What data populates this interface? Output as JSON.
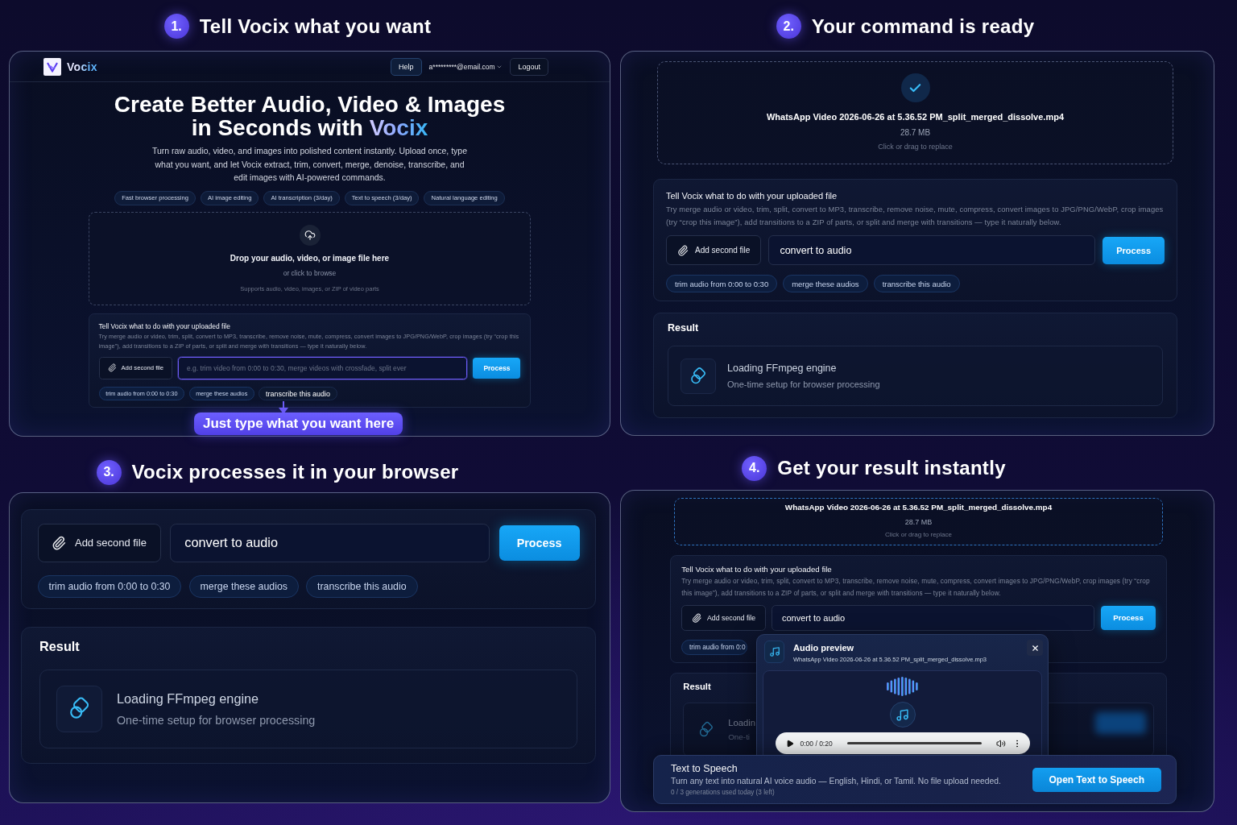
{
  "step_1": {
    "number": "1.",
    "title": "Tell Vocix what you want",
    "header": {
      "brand": "Vocix",
      "help": "Help",
      "account": "a*********@email.com",
      "logout": "Logout"
    },
    "hero": {
      "headline_lines": [
        "Create Better Audio, Video & Images",
        "in Seconds with"
      ],
      "headline_highlight": "Vocix",
      "intro": "Turn raw audio, video, and images into polished content instantly. Upload once, type what you want, and let Vocix extract, trim, convert, merge, denoise, transcribe, and edit images with AI-powered commands.",
      "features": [
        "Fast browser processing",
        "AI image editing",
        "AI transcription (3/day)",
        "Text to speech (3/day)",
        "Natural language editing"
      ]
    },
    "dropzone": {
      "title": "Drop your audio, video, or image file here",
      "browse": "or click to browse",
      "supports": "Supports audio, video, images, or ZIP of video parts"
    },
    "command": {
      "title": "Tell Vocix what to do with your uploaded file",
      "hint": "Try merge audio or video, trim, split, convert to MP3, transcribe, remove noise, mute, compress, convert images to JPG/PNG/WebP, crop images (try “crop this image”), add transitions to a ZIP of parts, or split and merge with transitions — type it naturally below.",
      "add_file": "Add second file",
      "input": {
        "placeholder": "e.g. trim video from 0:00 to 0:30, merge videos with crossfade, split ever",
        "focused": true
      },
      "process": "Process",
      "suggestions": [
        {
          "label": "trim audio from 0:00 to 0:30",
          "highlighted": false
        },
        {
          "label": "merge these audios",
          "highlighted": false
        },
        {
          "label": "transcribe this audio",
          "highlighted": true
        }
      ]
    },
    "callout": "Just type what you want here"
  },
  "step_2": {
    "number": "2.",
    "title": "Your command is ready",
    "file": {
      "name": "WhatsApp Video 2026-06-26 at 5.36.52 PM_split_merged_dissolve.mp4",
      "size": "28.7 MB",
      "action": "Click or drag to replace",
      "verified": true,
      "highlighted": false
    },
    "command": {
      "title": "Tell Vocix what to do with your uploaded file",
      "hint": "Try merge audio or video, trim, split, convert to MP3, transcribe, remove noise, mute, compress, convert images to JPG/PNG/WebP, crop images (try “crop this image”), add transitions to a ZIP of parts, or split and merge with transitions — type it naturally below.",
      "add_file": "Add second file",
      "input": {
        "value": "convert to audio",
        "focused": false
      },
      "process": "Process",
      "suggestions": [
        {
          "label": "trim audio from 0:00 to 0:30",
          "highlighted": false
        },
        {
          "label": "merge these audios",
          "highlighted": false
        },
        {
          "label": "transcribe this audio",
          "highlighted": false
        }
      ]
    },
    "result": {
      "title": "Result",
      "status": {
        "title": "Loading FFmpeg engine",
        "detail": "One-time setup for browser processing"
      },
      "dimmed": false
    }
  },
  "step_3": {
    "number": "3.",
    "title": "Vocix processes it in your browser",
    "command": {
      "add_file": "Add second file",
      "input": {
        "value": "convert to audio",
        "focused": false
      },
      "process": "Process",
      "suggestions": [
        {
          "label": "trim audio from 0:00 to 0:30",
          "highlighted": false
        },
        {
          "label": "merge these audios",
          "highlighted": false
        },
        {
          "label": "transcribe this audio",
          "highlighted": false
        }
      ]
    },
    "result": {
      "title": "Result",
      "status": {
        "title": "Loading FFmpeg engine",
        "detail": "One-time setup for browser processing"
      },
      "dimmed": false
    }
  },
  "step_4": {
    "number": "4.",
    "title": "Get your result instantly",
    "file": {
      "name": "WhatsApp Video 2026-06-26 at 5.36.52 PM_split_merged_dissolve.mp4",
      "size": "28.7 MB",
      "action": "Click or drag to replace",
      "highlighted": true
    },
    "command": {
      "title": "Tell Vocix what to do with your uploaded file",
      "hint": "Try merge audio or video, trim, split, convert to MP3, transcribe, remove noise, mute, compress, convert images to JPG/PNG/WebP, crop images (try “crop this image”), add transitions to a ZIP of parts, or split and merge with transitions — type it naturally below.",
      "add_file": "Add second file",
      "input": {
        "value": "convert to audio",
        "focused": false
      },
      "process": "Process",
      "suggestions": [
        {
          "label": "trim audio from 0:0",
          "highlighted": false
        }
      ]
    },
    "result": {
      "title": "Result",
      "status": {
        "title": "Loadin",
        "detail": "One-ti"
      },
      "dimmed": true
    },
    "audio_preview": {
      "title": "Audio preview",
      "file": "WhatsApp Video 2026-06-26 at 5.36.52 PM_split_merged_dissolve.mp3",
      "player": {
        "time": "0:00 / 0:20"
      }
    },
    "tts": {
      "title": "Text to Speech",
      "description": "Turn any text into natural AI voice audio — English, Hindi, or Tamil. No file upload needed.",
      "usage": "0 / 3 generations used today (3 left)",
      "action": "Open Text to Speech"
    }
  }
}
